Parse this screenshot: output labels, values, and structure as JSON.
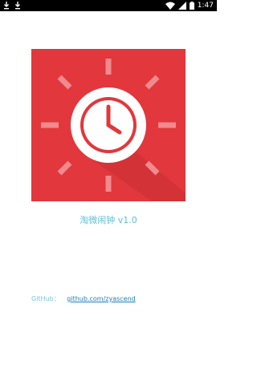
{
  "status_bar": {
    "left_icons": [
      "download-icon",
      "download-icon"
    ],
    "right_icons": [
      "wifi-icon",
      "signal-icon",
      "battery-icon"
    ],
    "time": "1:47"
  },
  "logo": {
    "icon": "alarm-clock-sun-icon",
    "colors": {
      "background": "#e2373c",
      "rays": "#f08a8d",
      "clock_face": "#ffffff",
      "hands": "#e2373c"
    }
  },
  "app": {
    "title": "淘微闹钟 v1.0"
  },
  "github": {
    "label": "GitHub：",
    "link_text": "github.com/zyascend"
  },
  "colors": {
    "accent": "#5bbfd6",
    "link": "#1d7fb8"
  }
}
